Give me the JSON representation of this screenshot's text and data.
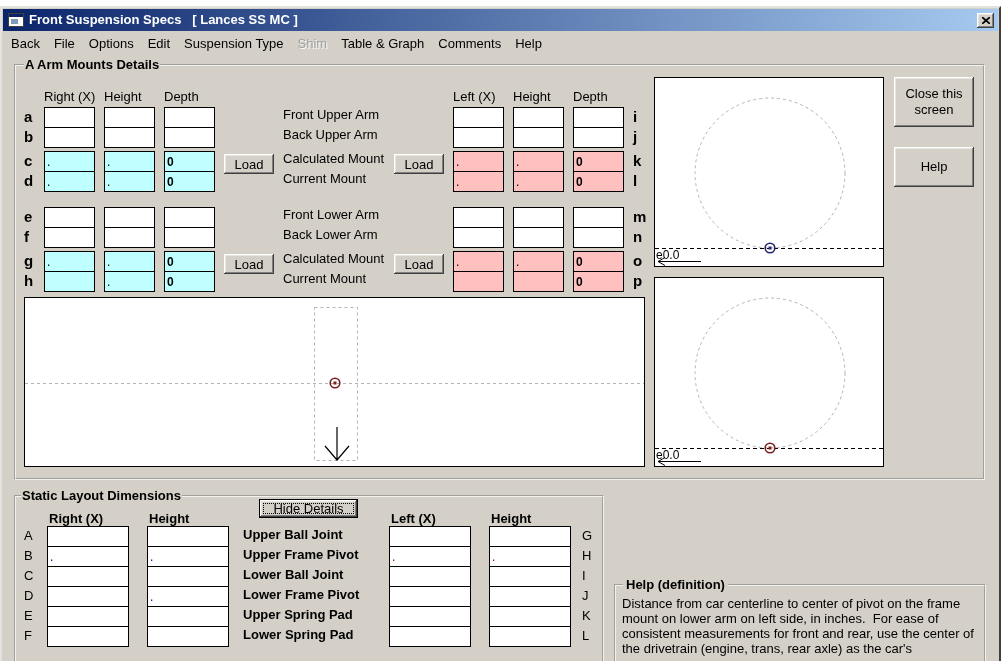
{
  "window": {
    "title": "Front Suspension Specs   [ Lances SS MC ]"
  },
  "menu": [
    {
      "label": "Back",
      "disabled": false
    },
    {
      "label": "File",
      "disabled": false
    },
    {
      "label": "Options",
      "disabled": false
    },
    {
      "label": "Edit",
      "disabled": false
    },
    {
      "label": "Suspension Type",
      "disabled": false
    },
    {
      "label": "Shim",
      "disabled": true
    },
    {
      "label": "Table & Graph",
      "disabled": false
    },
    {
      "label": "Comments",
      "disabled": false
    },
    {
      "label": "Help",
      "disabled": false
    }
  ],
  "arm_mounts": {
    "title": "A Arm Mounts Details",
    "right_columns": [
      "Right (X)",
      "Height",
      "Depth"
    ],
    "left_columns": [
      "Left (X)",
      "Height",
      "Depth"
    ],
    "groups": [
      {
        "load_buttons": [
          "Load",
          "Load"
        ],
        "rows": [
          {
            "kind": "arm",
            "right_letter": "a",
            "label": "Front Upper Arm",
            "left_letter": "i"
          },
          {
            "kind": "arm",
            "right_letter": "b",
            "label": "Back Upper Arm",
            "left_letter": "j"
          },
          {
            "kind": "mount",
            "right_letter": "c",
            "label": "Calculated Mount",
            "left_letter": "k",
            "right_values": {
              "x": ".",
              "height": ".",
              "depth": "0"
            },
            "left_values": {
              "x": ".",
              "height": ".",
              "depth": "0"
            }
          },
          {
            "kind": "mount",
            "right_letter": "d",
            "label": "Current Mount",
            "left_letter": "l",
            "right_values": {
              "x": ".",
              "height": ".",
              "depth": "0"
            },
            "left_values": {
              "x": ".",
              "height": ".",
              "depth": "0"
            }
          }
        ]
      },
      {
        "load_buttons": [
          "Load",
          "Load"
        ],
        "rows": [
          {
            "kind": "arm",
            "right_letter": "e",
            "label": "Front Lower Arm",
            "left_letter": "m"
          },
          {
            "kind": "arm",
            "right_letter": "f",
            "label": "Back Lower Arm",
            "left_letter": "n"
          },
          {
            "kind": "mount",
            "right_letter": "g",
            "label": "Calculated Mount",
            "left_letter": "o",
            "right_values": {
              "x": ".",
              "height": ".",
              "depth": "0"
            },
            "left_values": {
              "x": ".",
              "height": ".",
              "depth": "0"
            }
          },
          {
            "kind": "mount",
            "right_letter": "h",
            "label": "Current Mount",
            "left_letter": "p",
            "right_values": {
              "height": ".",
              "depth": "0"
            },
            "left_values": {
              "depth": "0"
            }
          }
        ]
      }
    ],
    "side_views": [
      {
        "label": "e0.0",
        "color": "#24246e"
      },
      {
        "label": "e0.0",
        "color": "#7a1e1e"
      }
    ],
    "side_buttons": [
      "Close this screen",
      "Help"
    ]
  },
  "static_layout": {
    "title": "Static Layout Dimensions",
    "toggle_button": {
      "label": "Hide Details",
      "focused": true
    },
    "right_columns": [
      "Right (X)",
      "Height"
    ],
    "left_columns": [
      "Left (X)",
      "Height"
    ],
    "rows": [
      {
        "right_letter": "A",
        "label": "Upper Ball Joint",
        "left_letter": "G"
      },
      {
        "right_letter": "B",
        "label": "Upper Frame Pivot",
        "left_letter": "H",
        "right_values": {
          "x": ".",
          "height": "."
        },
        "left_values": {
          "x": ".",
          "height": "."
        }
      },
      {
        "right_letter": "C",
        "label": "Lower Ball Joint",
        "left_letter": "I"
      },
      {
        "right_letter": "D",
        "label": "Lower Frame Pivot",
        "left_letter": "J",
        "right_values": {
          "height": "."
        }
      },
      {
        "right_letter": "E",
        "label": "Upper Spring Pad",
        "left_letter": "K"
      },
      {
        "right_letter": "F",
        "label": "Lower Spring Pad",
        "left_letter": "L"
      }
    ]
  },
  "help": {
    "title": "Help (definition)",
    "text": "Distance from car centerline to center of pivot on the frame mount on lower arm on left side, in inches.  For ease of consistent measurements for front and rear, use the center of the drivetrain (engine, trans, rear axle) as the car's"
  }
}
